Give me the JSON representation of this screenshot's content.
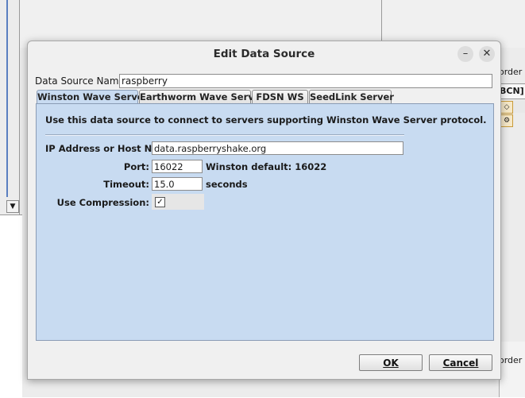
{
  "background": {
    "right_fragment_top": "order d",
    "right_fragment_bcn": "BCN]",
    "right_fragment_bottom": "order d",
    "left_drop_glyph": "▼"
  },
  "dialog": {
    "title": "Edit Data Source",
    "minimize_glyph": "–",
    "close_glyph": "✕",
    "data_source_name_label": "Data Source Name:",
    "data_source_name_value": "raspberry",
    "tabs": [
      {
        "label": "Winston Wave Server",
        "active": true
      },
      {
        "label": "Earthworm Wave Server",
        "active": false
      },
      {
        "label": "FDSN WS",
        "active": false
      },
      {
        "label": "SeedLink Server",
        "active": false
      }
    ],
    "panel": {
      "description": "Use this data source to connect to servers supporting Winston Wave Server protocol.",
      "host_label": "IP Address or Host Name:",
      "host_value": "data.raspberryshake.org",
      "port_label": "Port:",
      "port_value": "16022",
      "port_hint": "Winston default: 16022",
      "timeout_label": "Timeout:",
      "timeout_value": "15.0",
      "timeout_unit": "seconds",
      "compression_label": "Use Compression:",
      "compression_checked": true,
      "check_glyph": "✓"
    },
    "ok_label": "OK",
    "cancel_label": "Cancel"
  }
}
